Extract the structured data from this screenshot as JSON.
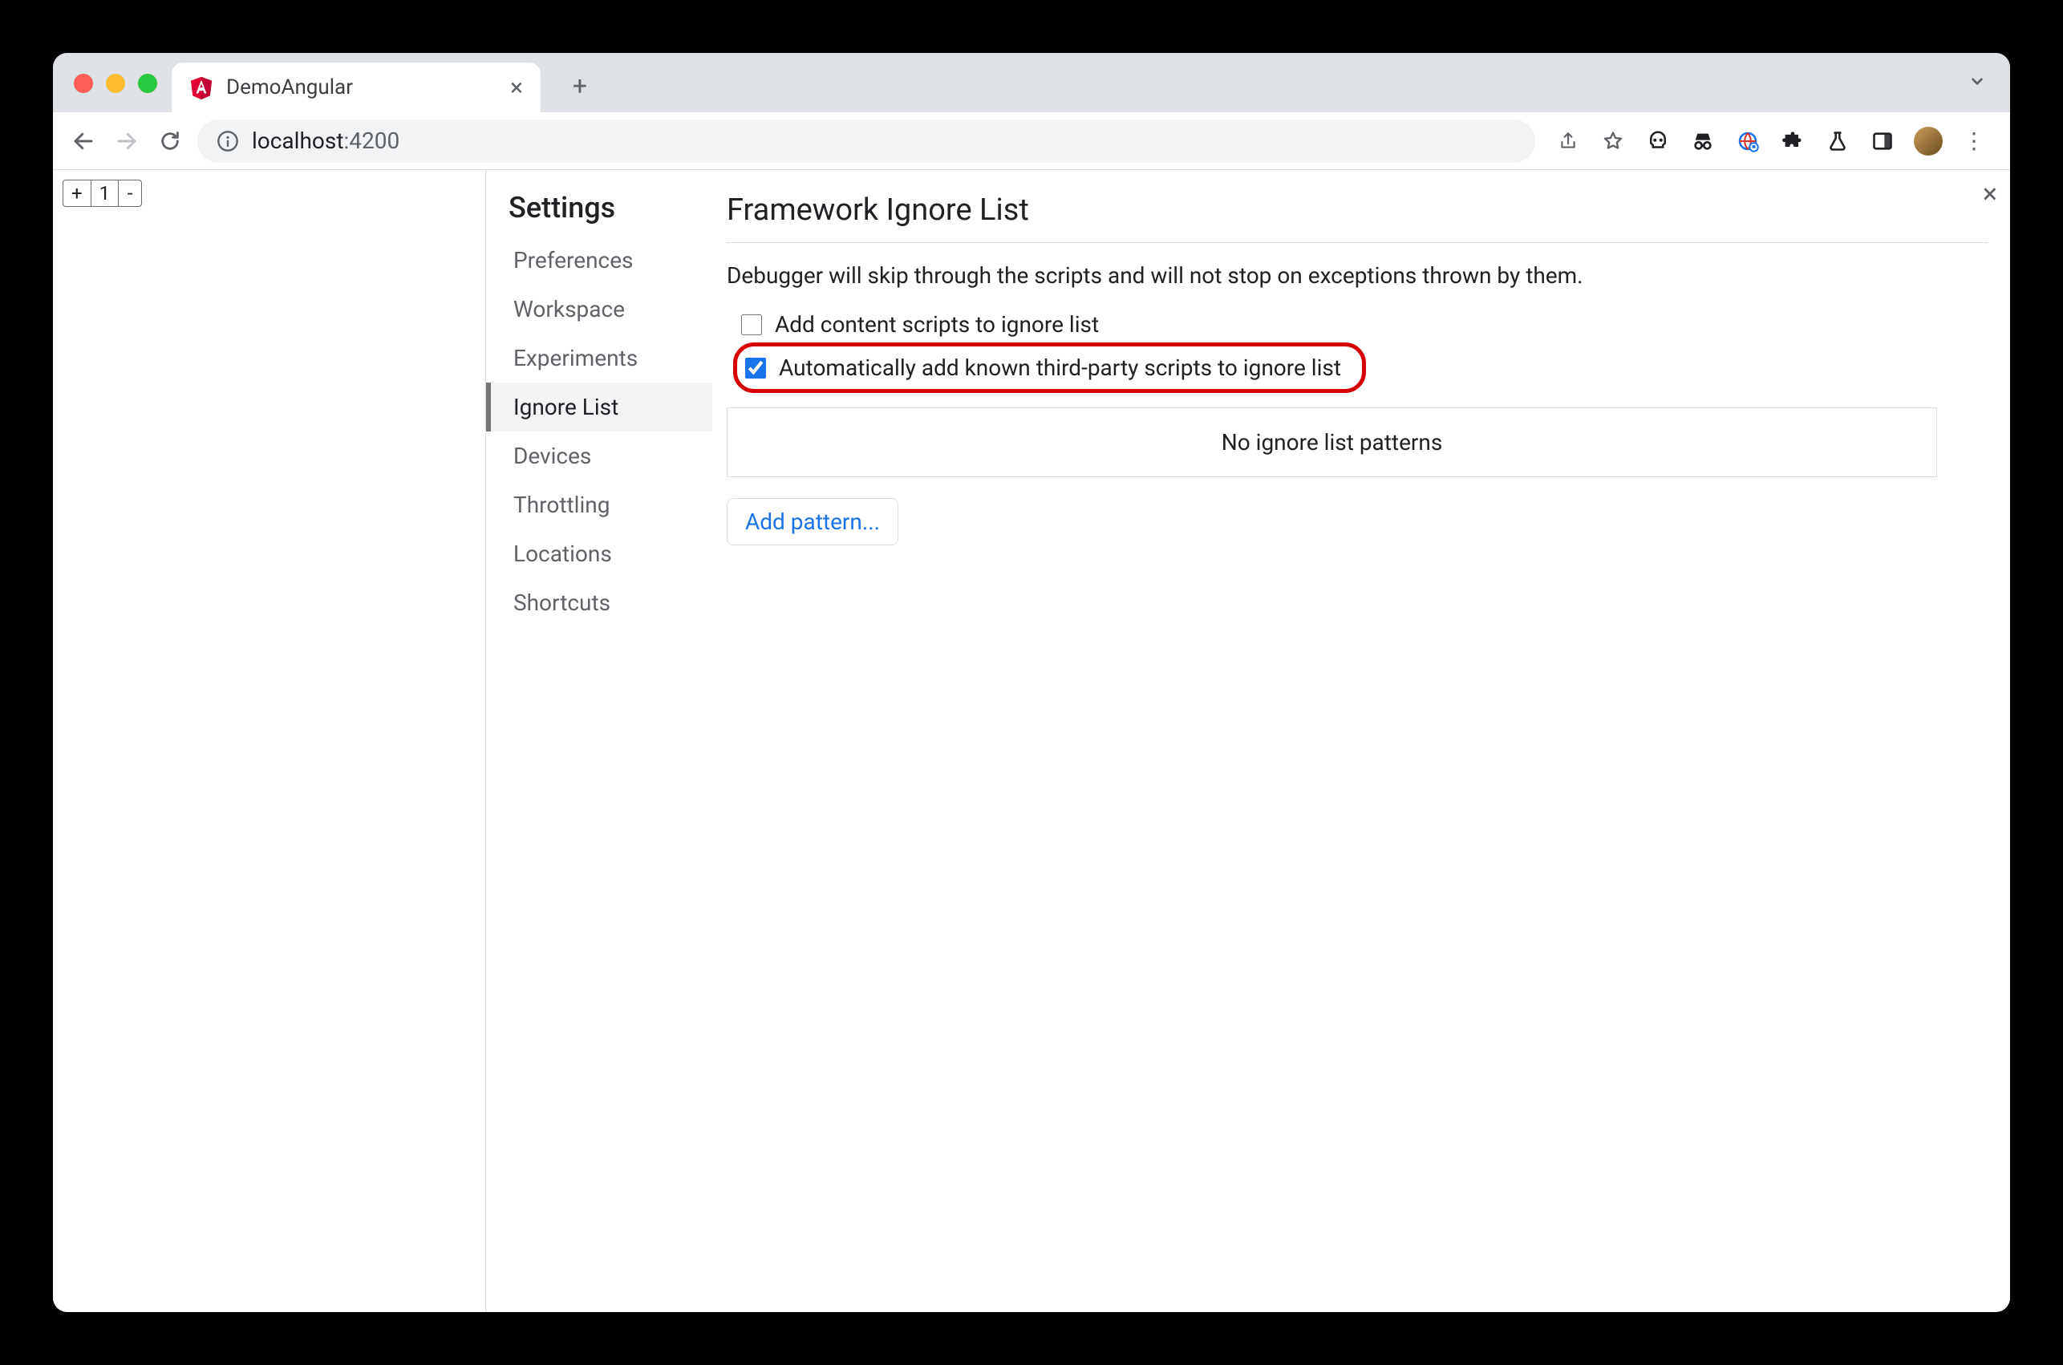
{
  "tab": {
    "title": "DemoAngular"
  },
  "url": {
    "host": "localhost",
    "port": ":4200"
  },
  "page_controls": {
    "plus": "+",
    "value": "1",
    "minus": "-"
  },
  "settings": {
    "title": "Settings",
    "items": [
      "Preferences",
      "Workspace",
      "Experiments",
      "Ignore List",
      "Devices",
      "Throttling",
      "Locations",
      "Shortcuts"
    ],
    "active_index": 3
  },
  "panel": {
    "title": "Framework Ignore List",
    "description": "Debugger will skip through the scripts and will not stop on exceptions thrown by them.",
    "checkbox1": {
      "label": "Add content scripts to ignore list",
      "checked": false
    },
    "checkbox2": {
      "label": "Automatically add known third-party scripts to ignore list",
      "checked": true
    },
    "empty_text": "No ignore list patterns",
    "add_button": "Add pattern..."
  }
}
